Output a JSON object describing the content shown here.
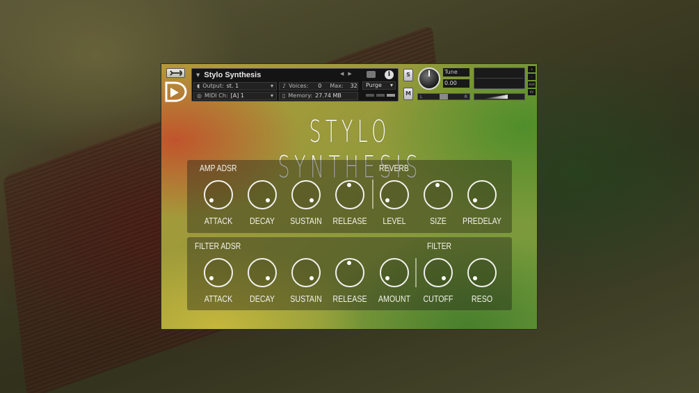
{
  "instrument": {
    "name": "Stylo Synthesis",
    "output_label": "Output:",
    "output_value": "st. 1",
    "midi_label": "MIDI Ch:",
    "midi_value": "[A] 1",
    "voices_label": "Voices:",
    "voices_value": "0",
    "max_label": "Max:",
    "max_value": "32",
    "memory_label": "Memory:",
    "memory_value": "27.74 MB",
    "purge_label": "Purge",
    "solo_label": "S",
    "mute_label": "M",
    "tune_label": "Tune",
    "tune_value": "0.00",
    "pan_left": "L",
    "pan_right": "R",
    "side_labels": [
      "x",
      "–",
      "AUX",
      "PV"
    ]
  },
  "title": "STYLO SYNTHESIS",
  "amp_panel": {
    "section_label": "AMP ADSR",
    "reverb_label": "REVERB",
    "knobs": [
      {
        "label": "ATTACK",
        "angle": 225
      },
      {
        "label": "DECAY",
        "angle": 135
      },
      {
        "label": "SUSTAIN",
        "angle": 135
      },
      {
        "label": "RELEASE",
        "angle": 0
      },
      {
        "label": "LEVEL",
        "angle": 225
      },
      {
        "label": "SIZE",
        "angle": 0
      },
      {
        "label": "PREDELAY",
        "angle": 225
      }
    ]
  },
  "filter_panel": {
    "section_label": "FILTER ADSR",
    "filter_label": "FILTER",
    "knobs": [
      {
        "label": "ATTACK",
        "angle": 225
      },
      {
        "label": "DECAY",
        "angle": 135
      },
      {
        "label": "SUSTAIN",
        "angle": 135
      },
      {
        "label": "RELEASE",
        "angle": 0
      },
      {
        "label": "AMOUNT",
        "angle": 225
      },
      {
        "label": "CUTOFF",
        "angle": 135
      },
      {
        "label": "RESO",
        "angle": 225
      }
    ]
  }
}
